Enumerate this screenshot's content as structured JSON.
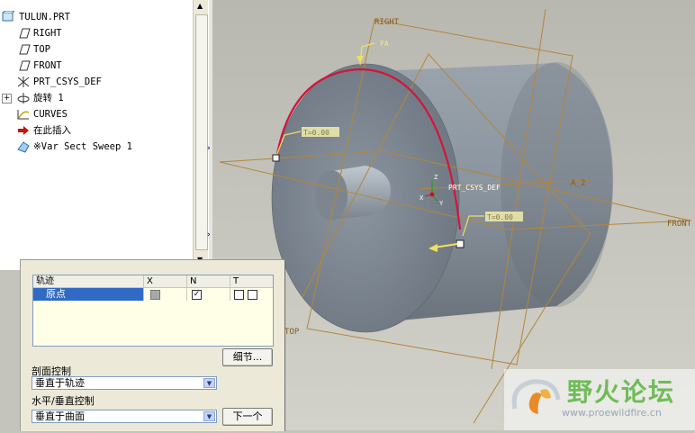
{
  "model_tree": {
    "root": "TULUN.PRT",
    "items": [
      {
        "label": "RIGHT",
        "icon": "datum-plane-icon"
      },
      {
        "label": "TOP",
        "icon": "datum-plane-icon"
      },
      {
        "label": "FRONT",
        "icon": "datum-plane-icon"
      },
      {
        "label": "PRT_CSYS_DEF",
        "icon": "coordinate-system-icon"
      },
      {
        "label": "旋转 1",
        "icon": "revolve-icon"
      },
      {
        "label": "CURVES",
        "icon": "curves-icon"
      },
      {
        "label": "在此插入",
        "icon": "insert-here-arrow-icon"
      },
      {
        "label": "※Var Sect Sweep 1",
        "icon": "sweep-icon"
      }
    ]
  },
  "viewport": {
    "labels": {
      "right": "RIGHT",
      "front": "FRONT",
      "top": "TOP",
      "axis": "A_2",
      "point": "PA",
      "csys": "PRT_CSYS_DEF",
      "t_start": "T=0.00",
      "t_end": "T=0.00",
      "axis_x": "X",
      "axis_y": "Y",
      "axis_z": "Z"
    },
    "colors": {
      "datum": "#b5853b",
      "trajectory": "#d4143c",
      "tag_bg": "#f2ecae"
    }
  },
  "dialog": {
    "table": {
      "headers": [
        "轨迹",
        "X",
        "N",
        "T"
      ],
      "rows": [
        {
          "name": "原点",
          "x": "gray",
          "n": "checked",
          "t": "unchecked-pair"
        }
      ]
    },
    "detail_button": "细节...",
    "section_control_label": "剖面控制",
    "section_control_value": "垂直于轨迹",
    "hv_control_label": "水平/垂直控制",
    "hv_control_value": "垂直于曲面",
    "next_button": "下一个"
  },
  "watermark": {
    "title": "野火论坛",
    "url": "www.proewildfire.cn"
  }
}
